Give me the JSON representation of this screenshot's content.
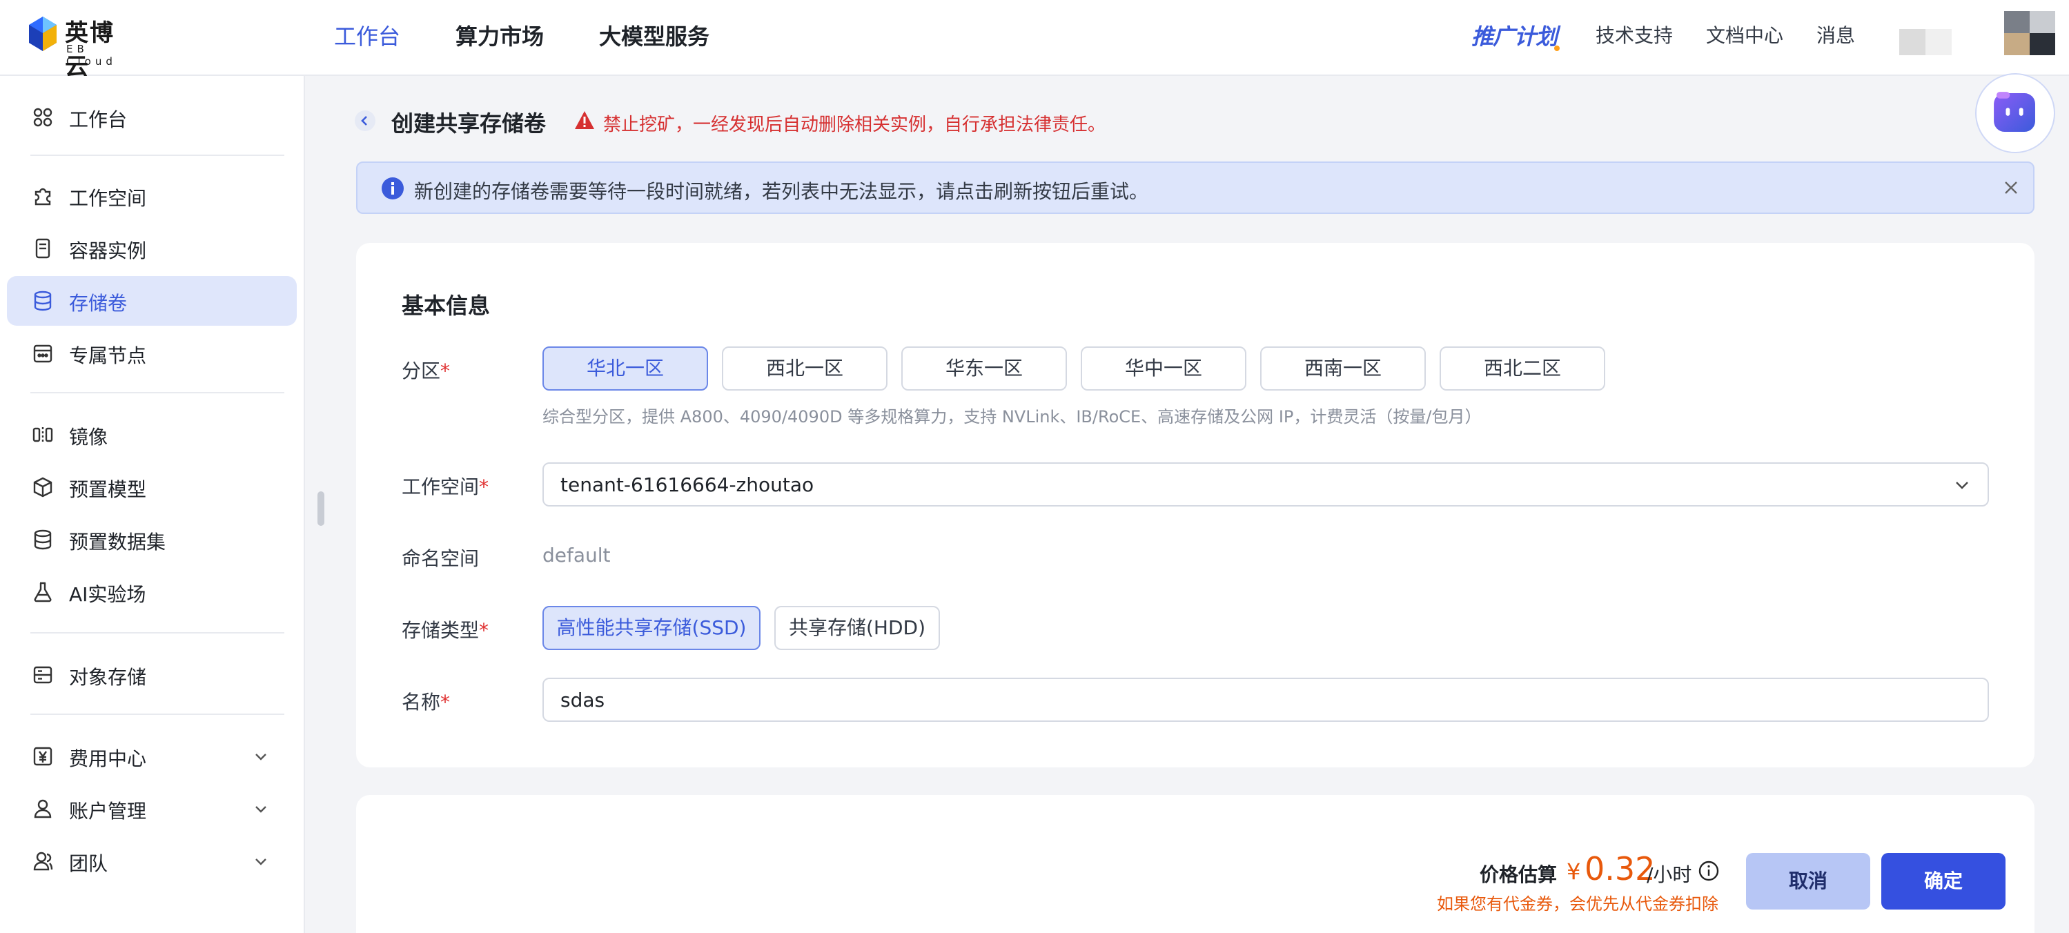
{
  "brand": {
    "name_cn": "英博云",
    "name_en": "EB Cloud"
  },
  "topnav": [
    {
      "label": "工作台",
      "active": true
    },
    {
      "label": "算力市场",
      "active": false
    },
    {
      "label": "大模型服务",
      "active": false
    }
  ],
  "header": {
    "promo": "推广计划",
    "links": [
      "技术支持",
      "文档中心",
      "消息"
    ]
  },
  "sidebar": {
    "items": [
      {
        "label": "工作台",
        "icon": "grid-icon"
      },
      {
        "label": "工作空间",
        "icon": "puzzle-icon"
      },
      {
        "label": "容器实例",
        "icon": "container-icon"
      },
      {
        "label": "存储卷",
        "icon": "database-icon",
        "active": true
      },
      {
        "label": "专属节点",
        "icon": "calendar-node-icon"
      },
      {
        "label": "镜像",
        "icon": "mirror-icon"
      },
      {
        "label": "预置模型",
        "icon": "cube-icon"
      },
      {
        "label": "预置数据集",
        "icon": "dataset-icon"
      },
      {
        "label": "AI实验场",
        "icon": "flask-icon"
      },
      {
        "label": "对象存储",
        "icon": "storage-icon"
      },
      {
        "label": "费用中心",
        "icon": "yen-icon",
        "expandable": true
      },
      {
        "label": "账户管理",
        "icon": "user-icon",
        "expandable": true
      },
      {
        "label": "团队",
        "icon": "team-icon",
        "expandable": true
      }
    ]
  },
  "page": {
    "title": "创建共享存储卷",
    "warning": "禁止挖矿，一经发现后自动删除相关实例，自行承担法律责任。",
    "alert": "新创建的存储卷需要等待一段时间就绪，若列表中无法显示，请点击刷新按钮后重试。"
  },
  "form": {
    "section_title": "基本信息",
    "region": {
      "label": "分区",
      "options": [
        "华北一区",
        "西北一区",
        "华东一区",
        "华中一区",
        "西南一区",
        "西北二区"
      ],
      "selected": "华北一区",
      "hint": "综合型分区，提供 A800、4090/4090D 等多规格算力，支持 NVLink、IB/RoCE、高速存储及公网 IP，计费灵活（按量/包月）"
    },
    "workspace": {
      "label": "工作空间",
      "value": "tenant-61616664-zhoutao"
    },
    "namespace": {
      "label": "命名空间",
      "value": "default"
    },
    "storage_type": {
      "label": "存储类型",
      "options": [
        "高性能共享存储(SSD)",
        "共享存储(HDD)"
      ],
      "selected": "高性能共享存储(SSD)"
    },
    "name": {
      "label": "名称",
      "value": "sdas"
    },
    "required_mark": "*"
  },
  "footer": {
    "price_label": "价格估算",
    "currency": "¥",
    "price": "0.32",
    "unit": "/小时",
    "note": "如果您有代金券，会优先从代金券扣除",
    "cancel": "取消",
    "confirm": "确定"
  },
  "colors": {
    "accent": "#3b5bdb",
    "warning": "#d63031",
    "price": "#e8590c"
  }
}
